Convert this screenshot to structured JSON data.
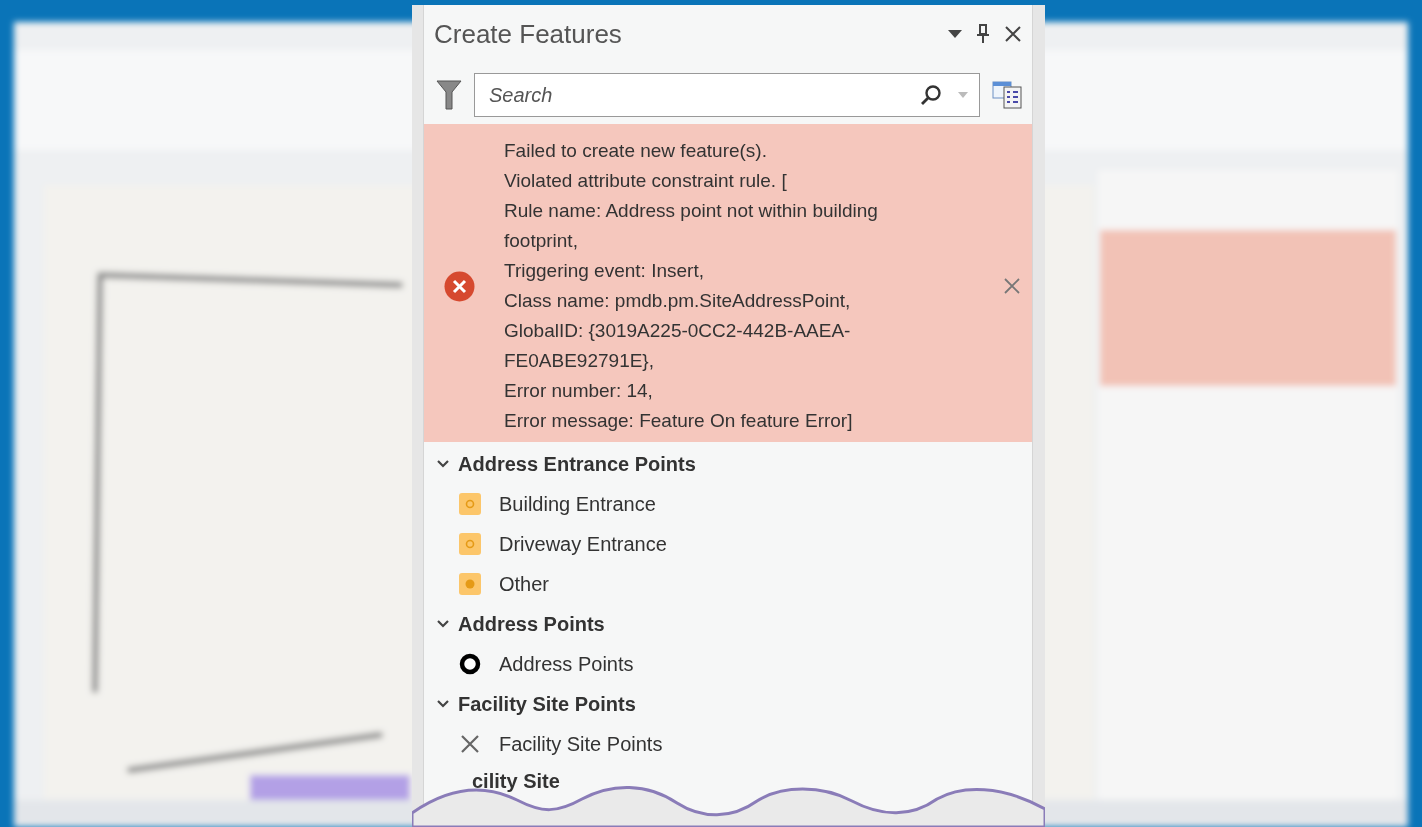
{
  "panel": {
    "title": "Create Features",
    "search": {
      "placeholder": "Search"
    },
    "error": {
      "lines": [
        "Failed to create new feature(s).",
        "Violated attribute constraint rule. [",
        "Rule name: Address point not within building",
        "footprint,",
        "Triggering event: Insert,",
        "Class name: pmdb.pm.SiteAddressPoint,",
        "GlobalID: {3019A225-0CC2-442B-AAEA-",
        "FE0ABE92791E},",
        "Error number: 14,",
        "Error message: Feature On feature Error]"
      ]
    },
    "groups": [
      {
        "label": "Address Entrance Points",
        "expanded": true,
        "items": [
          {
            "label": "Building Entrance",
            "kind": "entrance"
          },
          {
            "label": "Driveway Entrance",
            "kind": "entrance"
          },
          {
            "label": "Other",
            "kind": "other"
          }
        ]
      },
      {
        "label": "Address Points",
        "expanded": true,
        "items": [
          {
            "label": "Address Points",
            "kind": "address"
          }
        ]
      },
      {
        "label": "Facility Site Points",
        "expanded": true,
        "items": [
          {
            "label": "Facility Site Points",
            "kind": "facility"
          }
        ]
      }
    ],
    "cut_heading": "cility Site"
  }
}
